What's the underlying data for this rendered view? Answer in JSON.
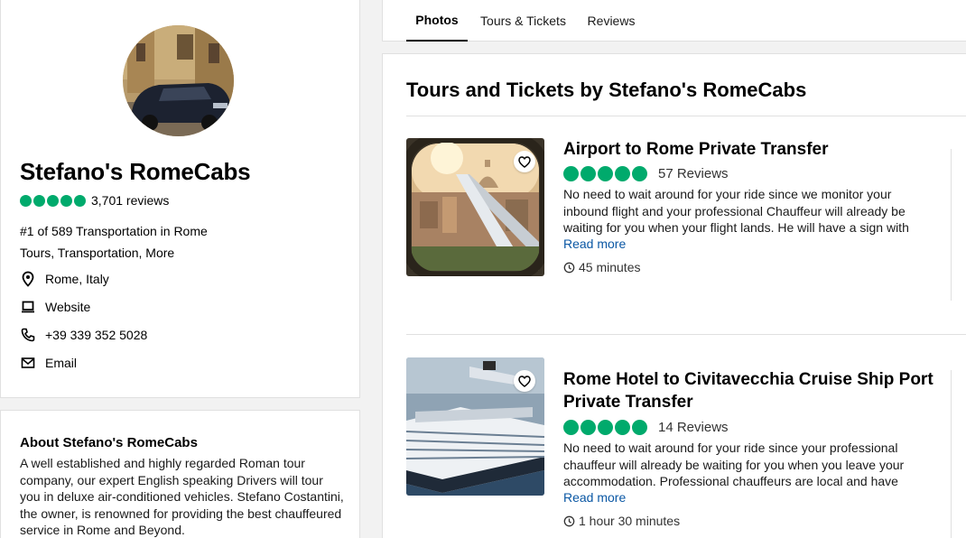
{
  "profile": {
    "name": "Stefano's RomeCabs",
    "rating_bubbles": 5,
    "reviews_count": "3,701 reviews",
    "rank": "#1 of 589 Transportation in Rome",
    "categories": "Tours, Transportation, More",
    "location": "Rome, Italy",
    "website_label": "Website",
    "phone": "+39 339 352 5028",
    "email_label": "Email"
  },
  "about": {
    "title": "About Stefano's RomeCabs",
    "text": "A well established and highly regarded Roman tour company, our expert English speaking Drivers will tour you in deluxe air-conditioned vehicles. Stefano Costantini, the owner, is renowned for providing the best chauffeured service in Rome and Beyond."
  },
  "tabs": [
    {
      "label": "Photos",
      "active": true
    },
    {
      "label": "Tours & Tickets",
      "active": false
    },
    {
      "label": "Reviews",
      "active": false
    }
  ],
  "main": {
    "section_title": "Tours and Tickets by Stefano's RomeCabs",
    "tours": [
      {
        "title": "Airport to Rome Private Transfer",
        "rating_bubbles": 5,
        "reviews": "57 Reviews",
        "description": "No need to wait around for your ride since we monitor your inbound flight and your professional Chauffeur will already be waiting for you when your flight lands. He will have a sign with",
        "read_more": "Read more",
        "duration": "45 minutes",
        "image": "airplane-window-view-of-rome"
      },
      {
        "title": "Rome Hotel to Civitavecchia Cruise Ship Port Private Transfer",
        "rating_bubbles": 5,
        "reviews": "14 Reviews",
        "description": "No need to wait around for your ride since your professional chauffeur will already be waiting for you when you leave your accommodation. Professional chauffeurs are local and have",
        "read_more": "Read more",
        "duration": "1 hour 30 minutes",
        "image": "cruise-ship"
      }
    ]
  },
  "colors": {
    "rating_green": "#00aa6c",
    "link_blue": "#0a57a4"
  }
}
